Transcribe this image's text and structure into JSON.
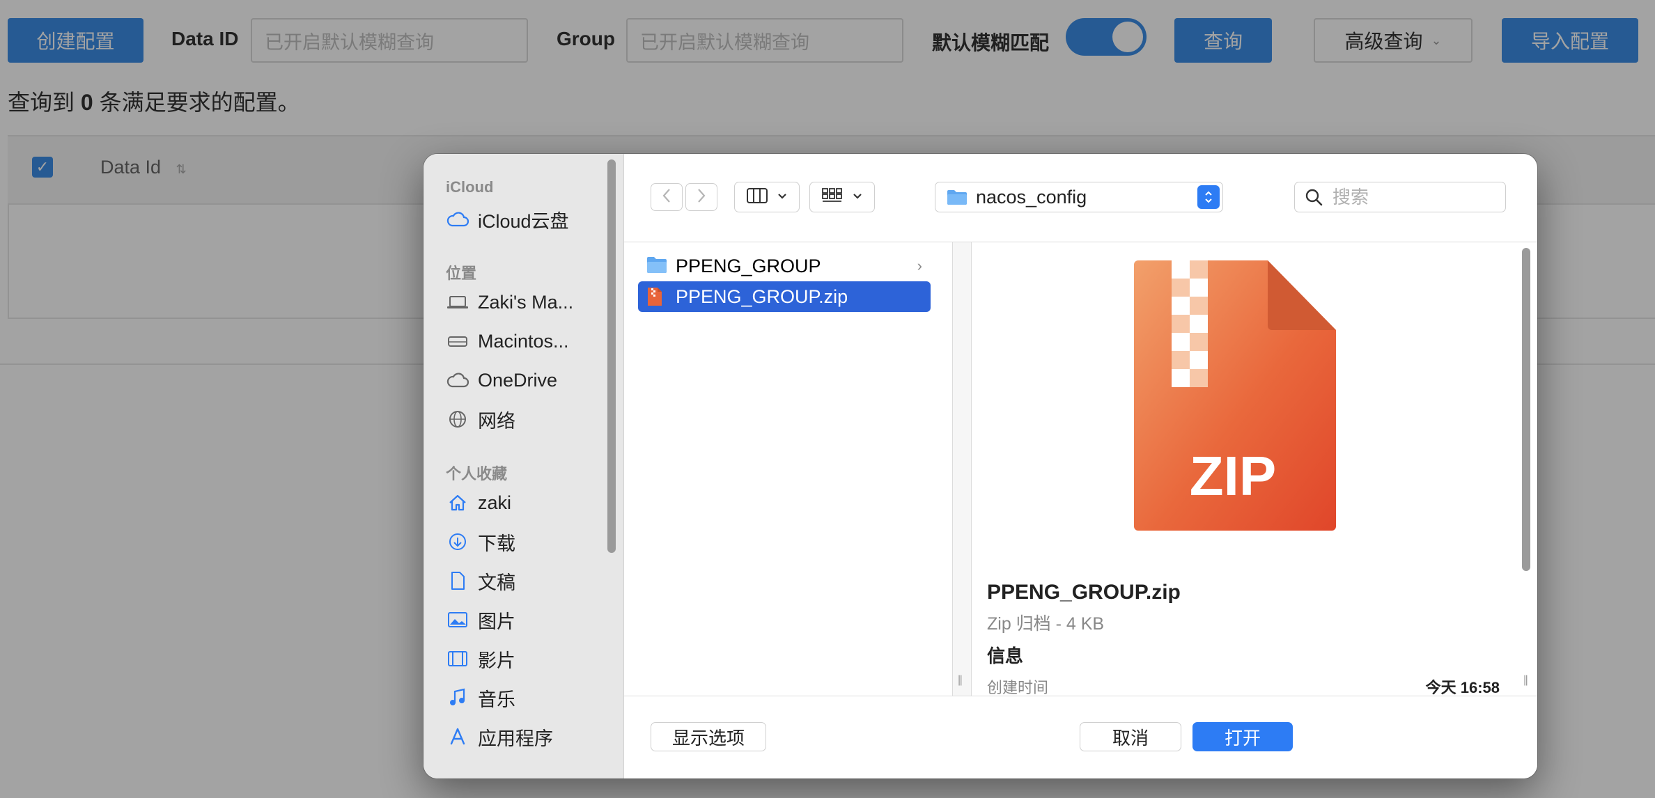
{
  "toolbar": {
    "create_button": "创建配置",
    "data_id_label": "Data ID",
    "data_id_placeholder": "已开启默认模糊查询",
    "group_label": "Group",
    "group_placeholder": "已开启默认模糊查询",
    "fuzzy_label": "默认模糊匹配",
    "fuzzy_enabled": true,
    "query_button": "查询",
    "advanced_query": "高级查询",
    "import_button": "导入配置"
  },
  "results": {
    "prefix": "查询到",
    "count": "0",
    "suffix": "条满足要求的配置。"
  },
  "table": {
    "columns": [
      "Data Id"
    ]
  },
  "dialog": {
    "sidebar": {
      "sections": [
        {
          "title": "iCloud",
          "items": [
            {
              "label": "iCloud云盘",
              "icon": "cloud-icon"
            }
          ]
        },
        {
          "title": "位置",
          "items": [
            {
              "label": "Zaki's Ma...",
              "icon": "laptop-icon"
            },
            {
              "label": "Macintos...",
              "icon": "disk-icon"
            },
            {
              "label": "OneDrive",
              "icon": "cloud-icon"
            },
            {
              "label": "网络",
              "icon": "globe-icon"
            }
          ]
        },
        {
          "title": "个人收藏",
          "items": [
            {
              "label": "zaki",
              "icon": "home-icon"
            },
            {
              "label": "下载",
              "icon": "download-icon"
            },
            {
              "label": "文稿",
              "icon": "document-icon"
            },
            {
              "label": "图片",
              "icon": "photo-icon"
            },
            {
              "label": "影片",
              "icon": "film-icon"
            },
            {
              "label": "音乐",
              "icon": "music-icon"
            },
            {
              "label": "应用程序",
              "icon": "apps-icon"
            }
          ]
        }
      ]
    },
    "location": "nacos_config",
    "search_placeholder": "搜索",
    "files": [
      {
        "name": "PPENG_GROUP",
        "kind": "folder",
        "selected": false
      },
      {
        "name": "PPENG_GROUP.zip",
        "kind": "zip",
        "selected": true
      }
    ],
    "preview": {
      "badge": "ZIP",
      "name": "PPENG_GROUP.zip",
      "kind": "Zip 归档 - 4 KB",
      "info_title": "信息",
      "created_label": "创建时间",
      "created_value": "今天 16:58"
    },
    "footer": {
      "options_button": "显示选项",
      "cancel_button": "取消",
      "open_button": "打开"
    },
    "accent": "#2d7cf4"
  }
}
